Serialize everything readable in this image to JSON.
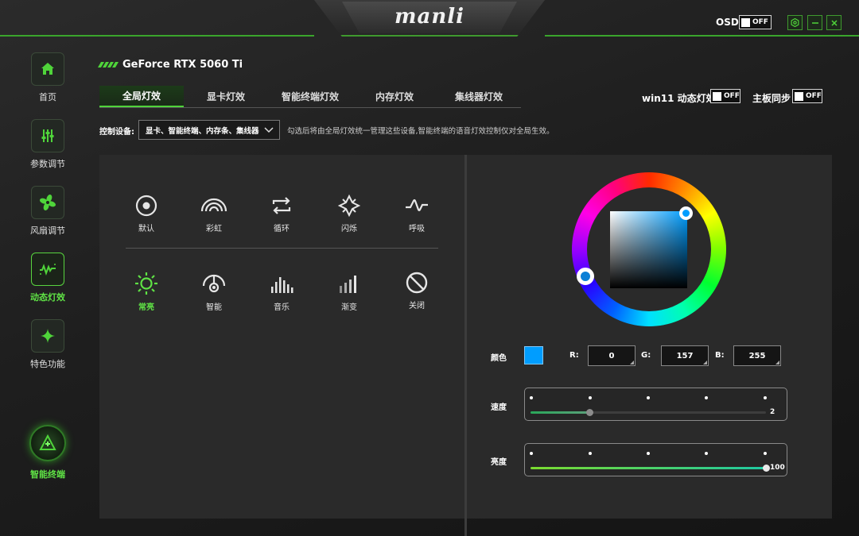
{
  "app": {
    "logo": "manli",
    "osd_label": "OSD",
    "osd_state": "OFF",
    "controls": [
      "settings-icon",
      "minimize-icon",
      "close-icon"
    ]
  },
  "sidebar": {
    "items": [
      {
        "label": "首页",
        "icon": "home-icon"
      },
      {
        "label": "参数调节",
        "icon": "sliders-icon"
      },
      {
        "label": "风扇调节",
        "icon": "fan-icon"
      },
      {
        "label": "动态灯效",
        "icon": "lighting-wave-icon",
        "active": true
      },
      {
        "label": "特色功能",
        "icon": "sparkle-icon"
      }
    ],
    "terminal": {
      "label": "智能终端",
      "icon": "smart-terminal-icon"
    }
  },
  "device": {
    "name": "GeForce RTX 5060 Ti"
  },
  "tabs": [
    {
      "label": "全局灯效",
      "active": true
    },
    {
      "label": "显卡灯效"
    },
    {
      "label": "智能终端灯效"
    },
    {
      "label": "内存灯效"
    },
    {
      "label": "集线器灯效"
    }
  ],
  "toggles": {
    "win11": {
      "label": "win11 动态灯效",
      "state": "OFF"
    },
    "mobo": {
      "label": "主板同步",
      "state": "OFF"
    }
  },
  "control_device": {
    "label": "控制设备:",
    "value": "显卡、智能终端、内存条、集线器",
    "note": "勾选后将由全局灯效统一管理这些设备,智能终端的语音灯效控制仅对全局生效。"
  },
  "modes": {
    "row1": [
      {
        "label": "默认",
        "icon": "default-icon"
      },
      {
        "label": "彩虹",
        "icon": "rainbow-icon"
      },
      {
        "label": "循环",
        "icon": "loop-icon"
      },
      {
        "label": "闪烁",
        "icon": "flash-icon"
      },
      {
        "label": "呼吸",
        "icon": "breathe-icon"
      }
    ],
    "row2": [
      {
        "label": "常亮",
        "icon": "always-on-icon",
        "active": true
      },
      {
        "label": "智能",
        "icon": "smart-icon"
      },
      {
        "label": "音乐",
        "icon": "music-icon"
      },
      {
        "label": "渐变",
        "icon": "gradient-icon"
      },
      {
        "label": "关闭",
        "icon": "off-icon"
      }
    ]
  },
  "color": {
    "label": "颜色",
    "hex": "#009dff",
    "r_label": "R:",
    "r": "0",
    "g_label": "G:",
    "g": "157",
    "b_label": "B:",
    "b": "255"
  },
  "speed": {
    "label": "速度",
    "value": "2",
    "level": 0.25
  },
  "brightness": {
    "label": "亮度",
    "value": "100",
    "level": 1.0
  },
  "accent_color": "#4fd43a"
}
